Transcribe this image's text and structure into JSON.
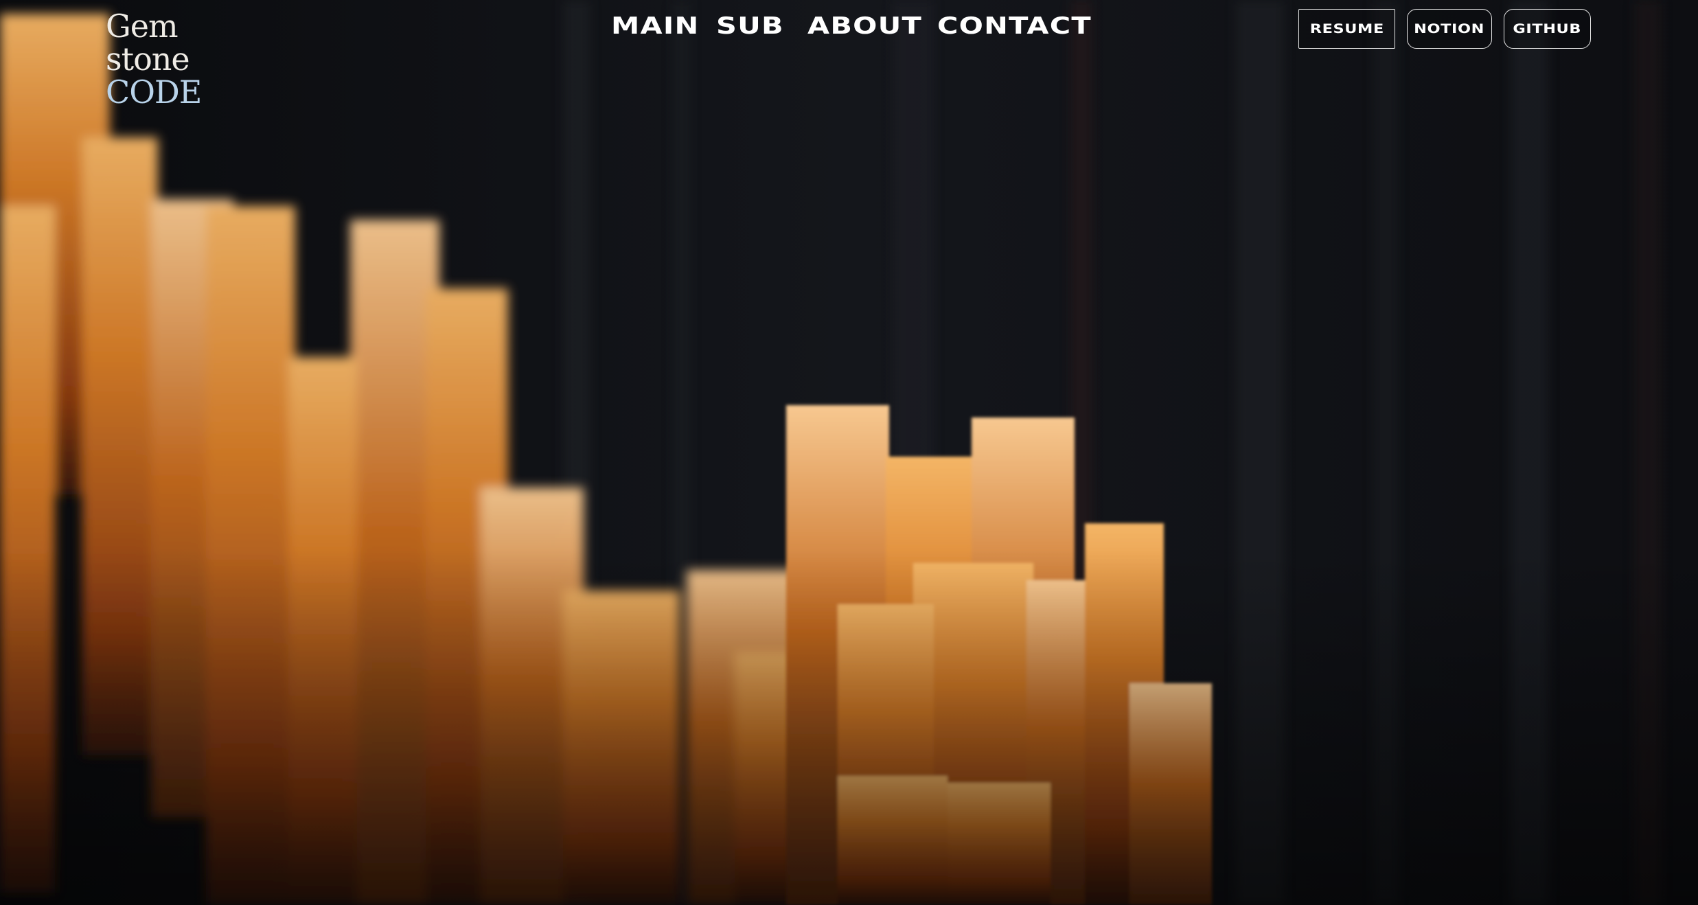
{
  "brand": {
    "line1": "Gem",
    "line2": "stone",
    "line3": "CODE"
  },
  "nav": {
    "main": "MAIN",
    "sub": "SUB",
    "about": "ABOUT",
    "contact": "CONTACT"
  },
  "actions": {
    "resume": "RESUME",
    "notion": "NOTION",
    "github": "GITHUB"
  },
  "colors": {
    "background": "#0b0b0d",
    "crystal": "#d9822b",
    "text": "#ffffff"
  }
}
